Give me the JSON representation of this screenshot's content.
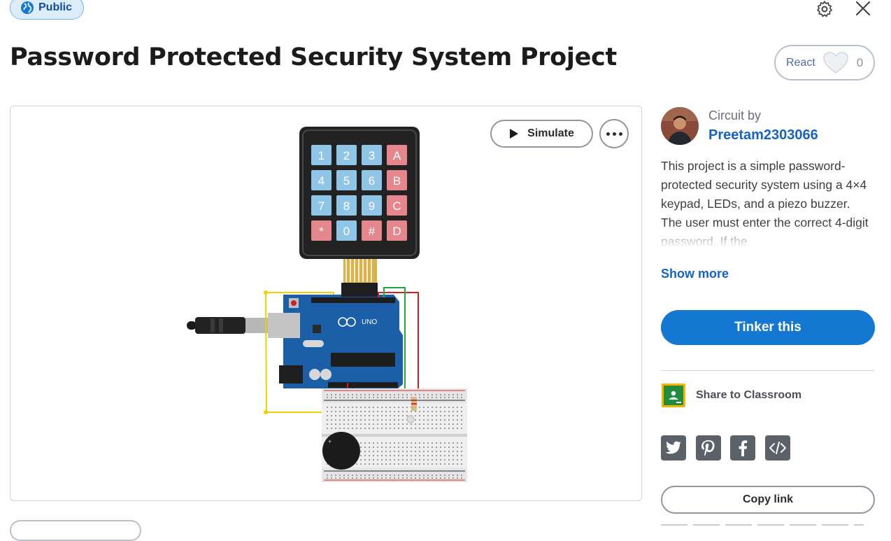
{
  "badge": {
    "label": "Public"
  },
  "header": {
    "title": "Password Protected Security System Project"
  },
  "react": {
    "label": "React",
    "count": "0"
  },
  "canvas": {
    "simulate_label": "Simulate",
    "keypad_keys": [
      "1",
      "2",
      "3",
      "A",
      "4",
      "5",
      "6",
      "B",
      "7",
      "8",
      "9",
      "C",
      "*",
      "0",
      "#",
      "D"
    ],
    "board_label": "UNO"
  },
  "author": {
    "circuit_by": "Circuit by",
    "name": "Preetam2303066"
  },
  "description": {
    "text": "This project is a simple password-protected security system using a 4×4 keypad, LEDs, and a piezo buzzer. The user must enter the correct 4-digit password. If the",
    "show_more": "Show more"
  },
  "actions": {
    "tinker": "Tinker this",
    "share_classroom": "Share to Classroom",
    "copy_link": "Copy link",
    "social": [
      "twitter-icon",
      "pinterest-icon",
      "facebook-icon",
      "embed-icon"
    ]
  },
  "colors": {
    "accent": "#1477d2",
    "link": "#1664c0",
    "badge_bg": "#dcecfa"
  }
}
